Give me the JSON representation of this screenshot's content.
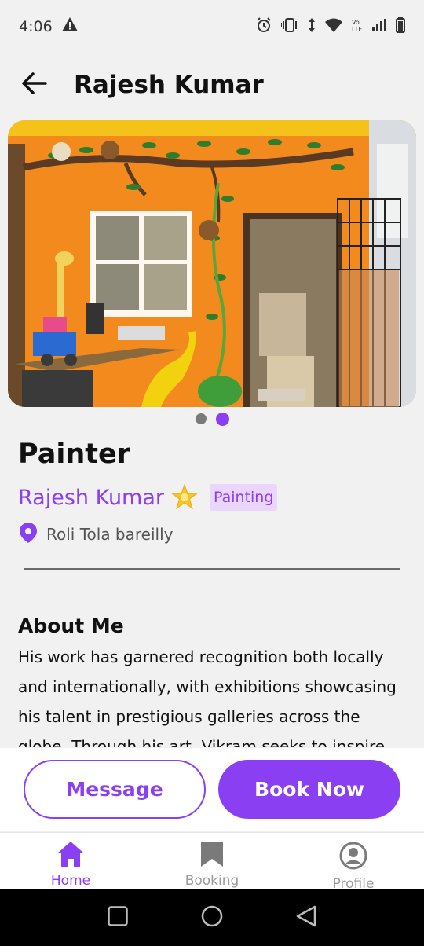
{
  "status_bar": {
    "time": "4:06",
    "icons": [
      "warning-icon",
      "alarm-icon",
      "vibrate-icon",
      "data-arrows-icon",
      "wifi-icon",
      "volte-icon",
      "signal-icon",
      "battery-icon"
    ]
  },
  "header": {
    "title": "Rajesh Kumar"
  },
  "carousel": {
    "slide_count": 2,
    "active_index": 1
  },
  "profile": {
    "profession": "Painter",
    "name": "Rajesh Kumar",
    "category": "Painting",
    "location": "Roli Tola bareilly"
  },
  "about": {
    "heading": "About Me",
    "text": "His work has garnered recognition both locally and internationally, with exhibitions showcasing his talent in prestigious galleries across the globe. Through his art, Vikram seeks to inspire others to appreciate the"
  },
  "actions": {
    "message_label": "Message",
    "book_label": "Book Now"
  },
  "bottom_nav": {
    "items": [
      {
        "label": "Home",
        "icon": "home-icon",
        "active": true
      },
      {
        "label": "Booking",
        "icon": "bookmark-icon",
        "active": false
      },
      {
        "label": "Profile",
        "icon": "profile-icon",
        "active": false
      }
    ]
  },
  "colors": {
    "accent": "#8a3ff3",
    "tag_bg": "#ead6ff",
    "background": "#f1f1f1"
  }
}
